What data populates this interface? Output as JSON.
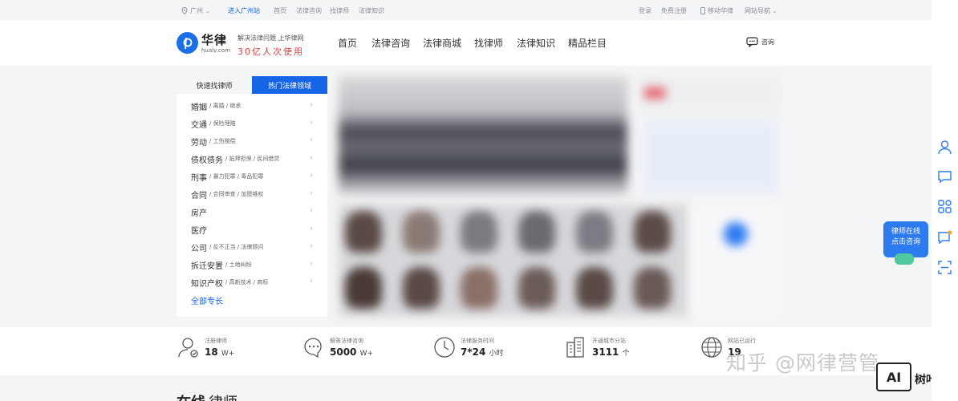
{
  "topbar": {
    "city": "广州",
    "enter_station": "进入广州站",
    "links": [
      "首页",
      "法律咨询",
      "找律师",
      "法律知识"
    ],
    "login": "登录",
    "register": "免费注册",
    "mobile": "移动华律",
    "site_nav": "网站导航"
  },
  "header": {
    "logo_name": "华律",
    "logo_domain": "hualv.com",
    "slogan_line1": "解决法律问题 上华律网",
    "slogan_line2": "30亿人次使用",
    "nav": [
      "首页",
      "法律咨询",
      "法律商城",
      "找律师",
      "法律知识",
      "精品栏目"
    ],
    "consult": "咨询"
  },
  "panel": {
    "tab_quick": "快速找律师",
    "tab_hot": "热门法律领域",
    "items": [
      {
        "main": "婚姻",
        "sub": "/ 离婚 / 继承"
      },
      {
        "main": "交通",
        "sub": "/ 保险理赔"
      },
      {
        "main": "劳动",
        "sub": "/ 工伤赔偿"
      },
      {
        "main": "债权债务",
        "sub": "/ 抵押担保 / 民间借贷"
      },
      {
        "main": "刑事",
        "sub": "/ 暴力犯罪 / 毒品犯罪"
      },
      {
        "main": "合同",
        "sub": "/ 合同审查 / 加盟维权"
      },
      {
        "main": "房产",
        "sub": ""
      },
      {
        "main": "医疗",
        "sub": ""
      },
      {
        "main": "公司",
        "sub": "/ 反不正当 / 法律顾问"
      },
      {
        "main": "拆迁安置",
        "sub": "/ 土地纠纷"
      },
      {
        "main": "知识产权",
        "sub": "/ 高新技术 / 商标"
      }
    ],
    "all": "全部专长"
  },
  "stats": [
    {
      "label": "注册律师",
      "value": "18",
      "unit": "W+"
    },
    {
      "label": "解答法律咨询",
      "value": "5000",
      "unit": "W+"
    },
    {
      "label": "法律服务时间",
      "value": "7*24",
      "unit": "小时"
    },
    {
      "label": "开通城市分站",
      "value": "3111",
      "unit": "个"
    },
    {
      "label": "网站已运行",
      "value": "19",
      "unit": ""
    }
  ],
  "bottom": {
    "heading_a": "在线",
    "heading_b": "律师"
  },
  "watermark": {
    "text": "知乎 @网律营管",
    "logo": "AI",
    "brand": "树叶云"
  },
  "bubble": {
    "line1": "律师在线",
    "line2": "点击咨询"
  },
  "colors": {
    "accent": "#1565e6",
    "slogan": "#e33d3d",
    "bubble": "#2c7bf0"
  }
}
